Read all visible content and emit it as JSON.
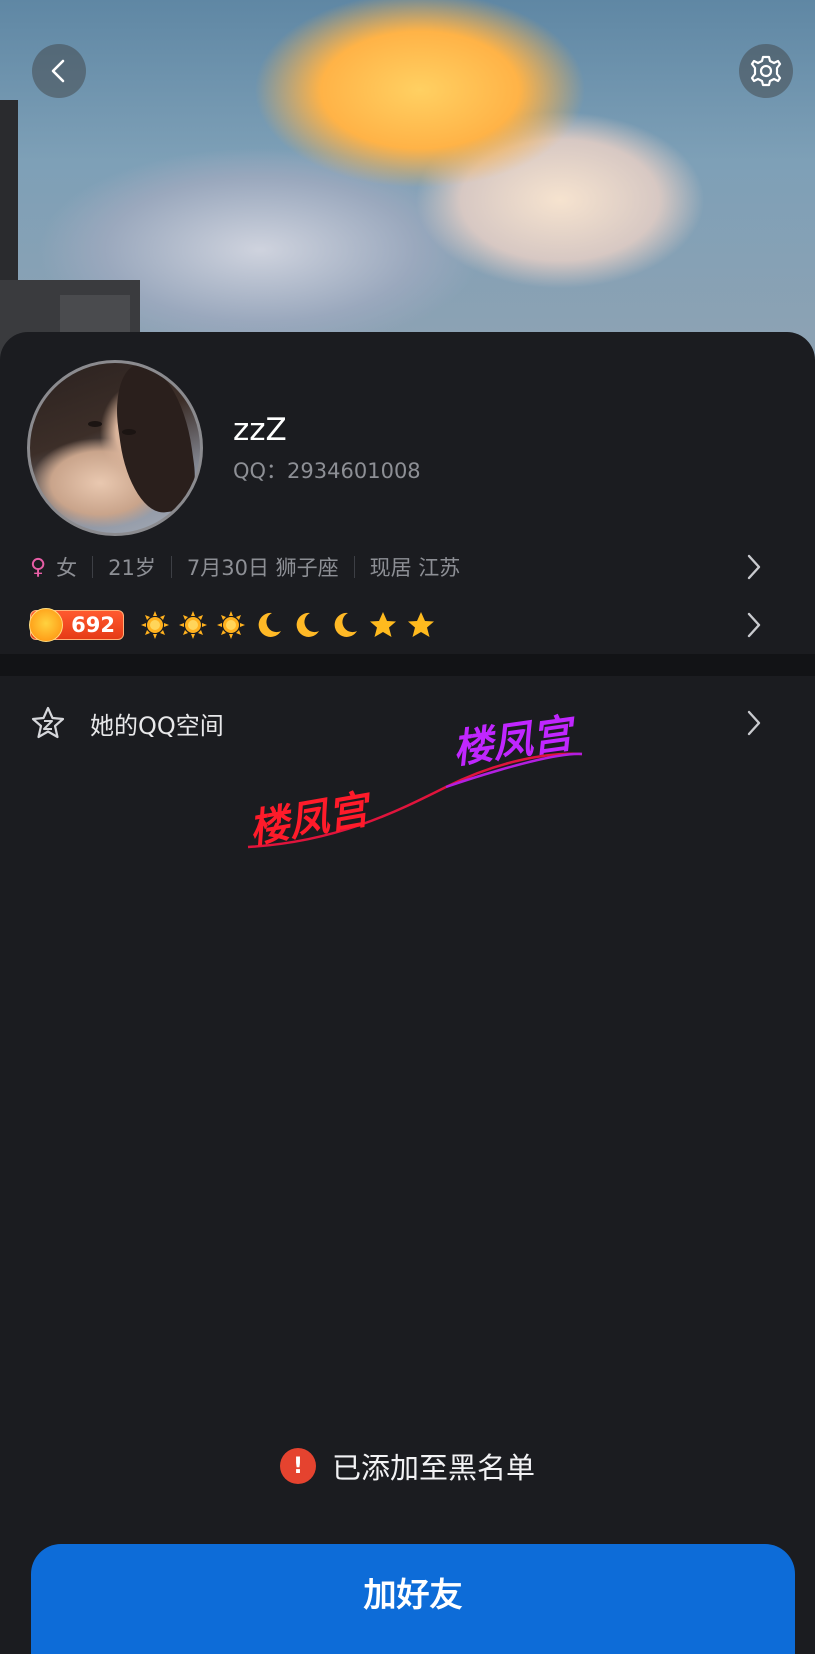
{
  "profile": {
    "name": "zzZ",
    "qq_label": "QQ：2934601008",
    "gender": "女",
    "age": "21岁",
    "birthday": "7月30日 狮子座",
    "location": "现居 江苏"
  },
  "level": {
    "value": "692",
    "icons": [
      "sun-icon",
      "sun-icon",
      "sun-icon",
      "moon-icon",
      "moon-icon",
      "moon-icon",
      "star-icon",
      "star-icon"
    ]
  },
  "qzone": {
    "label": "她的QQ空间"
  },
  "watermark": {
    "text_left": "楼凤宫",
    "text_right": "楼凤宫"
  },
  "status": {
    "blacklist_text": "已添加至黑名单"
  },
  "actions": {
    "add_friend_label": "加好友"
  },
  "colors": {
    "accent_blue": "#0d6cd8",
    "warning_red": "#e5432f",
    "female_pink": "#e85ea6",
    "background": "#1b1c20"
  }
}
